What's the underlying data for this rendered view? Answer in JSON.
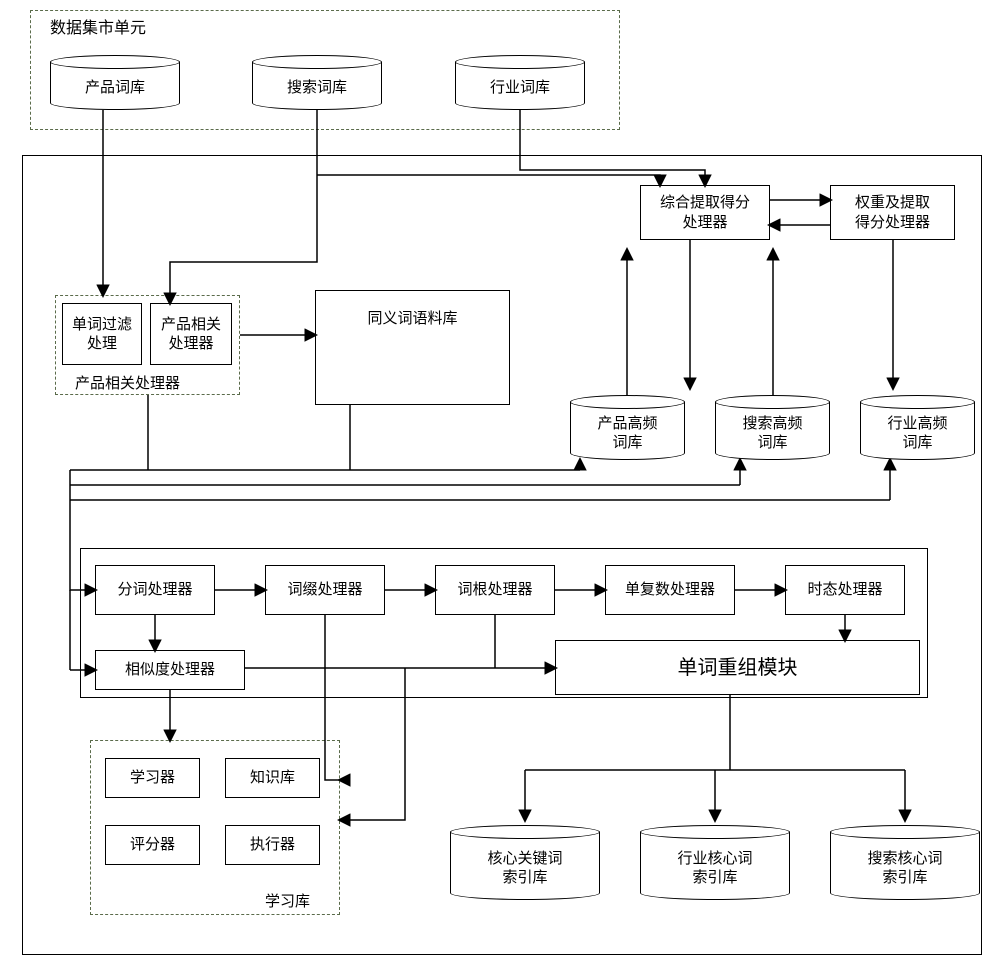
{
  "top_group_label": "数据集市单元",
  "cyl": {
    "product_lex": "产品词库",
    "search_lex": "搜索词库",
    "industry_lex": "行业词库",
    "product_hf": "产品高频\n词库",
    "search_hf": "搜索高频\n词库",
    "industry_hf": "行业高频\n词库",
    "core_keyword_idx": "核心关键词\n索引库",
    "industry_core_idx": "行业核心词\n索引库",
    "search_core_idx": "搜索核心词\n索引库"
  },
  "boxes": {
    "comprehensive_score": "综合提取得分\n处理器",
    "weight_score": "权重及提取\n得分处理器",
    "word_filter": "单词过滤\n处理",
    "product_related": "产品相关\n处理器",
    "product_related_group_label": "产品相关处理器",
    "synonym_corpus": "同义词语料库",
    "tokenizer": "分词处理器",
    "affix": "词缀处理器",
    "stem": "词根处理器",
    "number": "单复数处理器",
    "tense": "时态处理器",
    "similarity": "相似度处理器",
    "recombine": "单词重组模块",
    "learner": "学习器",
    "knowledge": "知识库",
    "scorer": "评分器",
    "executor": "执行器",
    "learning_group_label": "学习库"
  }
}
